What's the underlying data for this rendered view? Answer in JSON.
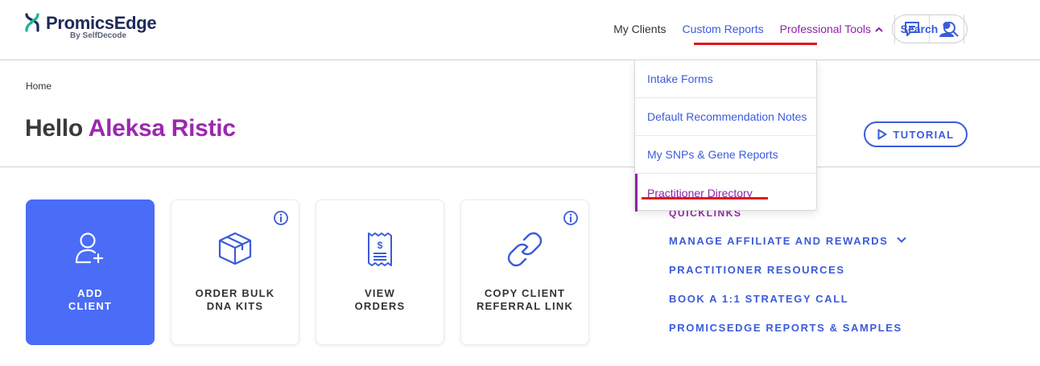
{
  "brand": {
    "name": "PromicsEdge",
    "sub": "By SelfDecode"
  },
  "nav": {
    "my_clients": "My Clients",
    "custom_reports": "Custom Reports",
    "professional_tools": "Professional Tools",
    "search": "Search"
  },
  "dropdown": {
    "items": [
      {
        "label": "Intake Forms"
      },
      {
        "label": "Default Recommendation Notes"
      },
      {
        "label": "My SNPs & Gene Reports"
      },
      {
        "label": "Practitioner Directory"
      }
    ]
  },
  "breadcrumb": "Home",
  "greeting": {
    "hello": "Hello",
    "name": "Aleksa Ristic"
  },
  "tutorial": "TUTORIAL",
  "cards": [
    {
      "label": "ADD\nCLIENT",
      "icon": "add-user-icon"
    },
    {
      "label": "ORDER BULK\nDNA KITS",
      "icon": "box-icon"
    },
    {
      "label": "VIEW\nORDERS",
      "icon": "receipt-icon"
    },
    {
      "label": "COPY CLIENT\nREFERRAL LINK",
      "icon": "link-icon"
    }
  ],
  "quicklinks": {
    "title": "QUICKLINKS",
    "links": [
      {
        "label": "MANAGE AFFILIATE AND REWARDS"
      },
      {
        "label": "PRACTITIONER RESOURCES"
      },
      {
        "label": "BOOK A 1:1 STRATEGY CALL"
      },
      {
        "label": "PROMICSEDGE REPORTS & SAMPLES"
      }
    ]
  },
  "colors": {
    "brand_blue": "#3b5bdb",
    "primary_card": "#4a6cf7",
    "accent_purple": "#9c27b0",
    "highlight_red": "#e2141d"
  }
}
